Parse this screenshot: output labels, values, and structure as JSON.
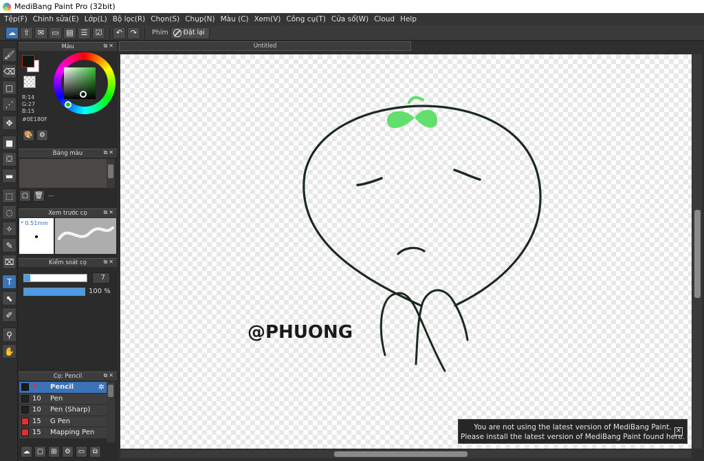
{
  "title": "MediBang Paint Pro (32bit)",
  "menu": [
    "Tệp(F)",
    "Chỉnh sửa(E)",
    "Lớp(L)",
    "Bộ lọc(R)",
    "Chọn(S)",
    "Chụp(N)",
    "Màu (C)",
    "Xem(V)",
    "Công cụ(T)",
    "Cửa sổ(W)",
    "Cloud",
    "Help"
  ],
  "toolbar": {
    "key_label": "Phím",
    "reset_label": "Đặt lại"
  },
  "panels": {
    "color": {
      "title": "Màu",
      "r": "R:14",
      "g": "G:27",
      "b": "B:15",
      "hex": "#0E180F",
      "fg": "#0E180F"
    },
    "palette": {
      "title": "Bảng màu",
      "dash": "---"
    },
    "preview": {
      "title": "Xem trước cọ",
      "size": "* 0.51mm"
    },
    "brush_control": {
      "title": "Kiểm soát cọ",
      "size_value": "7",
      "opacity": "100 %",
      "size_fraction": 0.12
    },
    "brush": {
      "title": "Cọ: Pencil",
      "items": [
        {
          "size": "7",
          "name": "Pencil",
          "color": "#1a1a1a"
        },
        {
          "size": "10",
          "name": "Pen",
          "color": "#222222"
        },
        {
          "size": "10",
          "name": "Pen (Sharp)",
          "color": "#222222"
        },
        {
          "size": "15",
          "name": "G Pen",
          "color": "#e03030"
        },
        {
          "size": "15",
          "name": "Mapping Pen",
          "color": "#e03030"
        }
      ]
    }
  },
  "document": {
    "tab": "Untitled",
    "signature": "@PHUONG"
  },
  "notification": {
    "line1": "You are not using the latest version of MediBang Paint.",
    "line2": "Please install the latest version of MediBang Paint found here.",
    "close": "✕"
  }
}
